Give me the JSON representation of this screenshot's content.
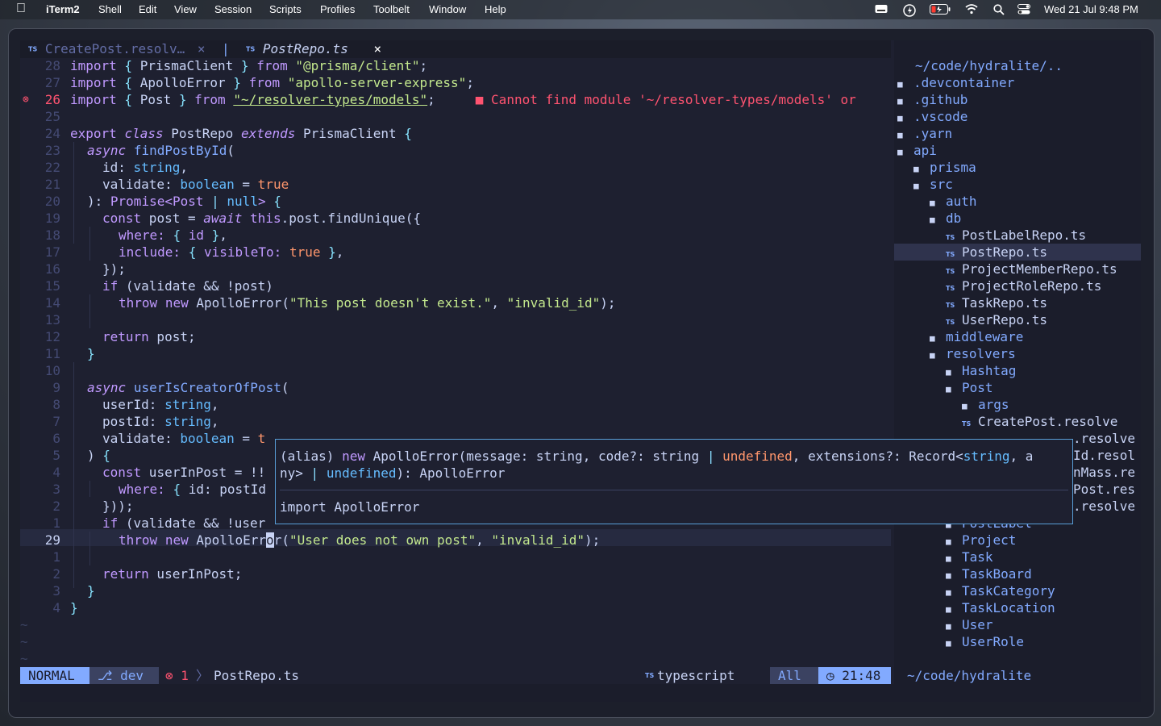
{
  "menubar": {
    "apple": "",
    "app": "iTerm2",
    "items": [
      "Shell",
      "Edit",
      "View",
      "Session",
      "Scripts",
      "Profiles",
      "Toolbelt",
      "Window",
      "Help"
    ],
    "clock": "Wed 21 Jul  9:48 PM"
  },
  "tabs": [
    {
      "badge": "TS",
      "label": "CreatePost.resolv…",
      "close": "×"
    },
    {
      "badge": "TS",
      "label": "PostRepo.ts",
      "close": "×"
    }
  ],
  "tab_separator": "|",
  "lines": [
    {
      "n": "28"
    },
    {
      "n": "27"
    },
    {
      "n": "26"
    },
    {
      "n": "25"
    },
    {
      "n": "24"
    },
    {
      "n": "23"
    },
    {
      "n": "22"
    },
    {
      "n": "21"
    },
    {
      "n": "20"
    },
    {
      "n": "19"
    },
    {
      "n": "18"
    },
    {
      "n": "17"
    },
    {
      "n": "16"
    },
    {
      "n": "15"
    },
    {
      "n": "14"
    },
    {
      "n": "13"
    },
    {
      "n": "12"
    },
    {
      "n": "11"
    },
    {
      "n": "10"
    },
    {
      "n": "9"
    },
    {
      "n": "8"
    },
    {
      "n": "7"
    },
    {
      "n": "6"
    },
    {
      "n": "5"
    },
    {
      "n": "4"
    },
    {
      "n": "3"
    },
    {
      "n": "2"
    },
    {
      "n": "1"
    },
    {
      "n": "29"
    },
    {
      "n": "1"
    },
    {
      "n": "2"
    },
    {
      "n": "3"
    },
    {
      "n": "4"
    }
  ],
  "code": {
    "l28": [
      "import",
      " { ",
      "PrismaClient",
      " } ",
      "from",
      " ",
      "\"@prisma/client\"",
      ";"
    ],
    "l27": [
      "import",
      " { ",
      "ApolloError",
      " } ",
      "from",
      " ",
      "\"apollo-server-express\"",
      ";"
    ],
    "l26": [
      "import",
      " { ",
      "Post",
      " } ",
      "from",
      " ",
      "\"~/resolver-types/models\"",
      ";"
    ],
    "l26_diag": "■ Cannot find module '~/resolver-types/models' or",
    "l24": [
      "export",
      " ",
      "class",
      " PostRepo ",
      "extends",
      " PrismaClient ",
      "{"
    ],
    "l23": [
      "async",
      " ",
      "findPostById",
      "("
    ],
    "l22": [
      "id: ",
      "string",
      ","
    ],
    "l21": [
      "validate: ",
      "boolean",
      " = ",
      "true"
    ],
    "l20": [
      "): ",
      "Promise",
      "<Post ",
      "|",
      " null",
      "> ",
      "{"
    ],
    "l19": [
      "const",
      " post = ",
      "await",
      " ",
      "this",
      ".post.findUnique({"
    ],
    "l18": [
      "where: ",
      "{",
      " id ",
      "}",
      ","
    ],
    "l17": [
      "include: ",
      "{",
      " visibleTo: ",
      "true",
      " ",
      "}",
      ","
    ],
    "l16": "});",
    "l15": [
      "if",
      " (validate && !post)"
    ],
    "l14": [
      "throw",
      " ",
      "new",
      " ApolloError(",
      "\"This post doesn't exist.\"",
      ", ",
      "\"invalid_id\"",
      ");"
    ],
    "l12": [
      "return",
      " post;"
    ],
    "l11": "}",
    "l9": [
      "async",
      " ",
      "userIsCreatorOfPost",
      "("
    ],
    "l8": [
      "userId: ",
      "string",
      ","
    ],
    "l7": [
      "postId: ",
      "string",
      ","
    ],
    "l6": [
      "validate: ",
      "boolean",
      " = ",
      "t"
    ],
    "l5": [
      ") ",
      "{"
    ],
    "l4": [
      "const",
      " userInPost = !!"
    ],
    "l3": [
      "where: ",
      "{",
      " id: postId"
    ],
    "l2": "}));",
    "l1": [
      "if",
      " (validate && !user"
    ],
    "l29": [
      "throw",
      " ",
      "new",
      " ApolloErr",
      "o",
      "r(",
      "\"User does not own post\"",
      ", ",
      "\"invalid_id\"",
      ");"
    ],
    "r2": [
      "return",
      " userInPost;"
    ],
    "r3": "}",
    "r4": "}",
    "tilde": "~"
  },
  "popup": {
    "line1": [
      "(alias) ",
      "new",
      " ApolloError(message: string, code?: string ",
      "|",
      " ",
      "undefined",
      ", extensions?: Record<",
      "string",
      ", a"
    ],
    "line2": [
      "ny> ",
      "|",
      " ",
      "undefined",
      "): ApolloError"
    ],
    "line3": "import ApolloError"
  },
  "tree": {
    "title": "~/code/hydralite/..",
    "folder_glyph": "■",
    "file_badge": "TS",
    "items": [
      {
        "label": ".devcontainer",
        "type": "folder",
        "depth": 0
      },
      {
        "label": ".github",
        "type": "folder",
        "depth": 0
      },
      {
        "label": ".vscode",
        "type": "folder",
        "depth": 0
      },
      {
        "label": ".yarn",
        "type": "folder",
        "depth": 0
      },
      {
        "label": "api",
        "type": "folder",
        "depth": 0
      },
      {
        "label": "prisma",
        "type": "folder",
        "depth": 1
      },
      {
        "label": "src",
        "type": "folder",
        "depth": 1
      },
      {
        "label": "auth",
        "type": "folder",
        "depth": 2
      },
      {
        "label": "db",
        "type": "folder",
        "depth": 2
      },
      {
        "label": "PostLabelRepo.ts",
        "type": "file",
        "depth": 3
      },
      {
        "label": "PostRepo.ts",
        "type": "file",
        "depth": 3,
        "selected": true
      },
      {
        "label": "ProjectMemberRepo.ts",
        "type": "file",
        "depth": 3
      },
      {
        "label": "ProjectRoleRepo.ts",
        "type": "file",
        "depth": 3
      },
      {
        "label": "TaskRepo.ts",
        "type": "file",
        "depth": 3
      },
      {
        "label": "UserRepo.ts",
        "type": "file",
        "depth": 3
      },
      {
        "label": "middleware",
        "type": "folder",
        "depth": 2
      },
      {
        "label": "resolvers",
        "type": "folder",
        "depth": 2
      },
      {
        "label": "Hashtag",
        "type": "folder",
        "depth": 3
      },
      {
        "label": "Post",
        "type": "folder",
        "depth": 3
      },
      {
        "label": "args",
        "type": "folder",
        "depth": 4
      },
      {
        "label": "CreatePost.resolve",
        "type": "file",
        "depth": 4
      }
    ],
    "hidden_fragments": [
      ".resolve",
      "Id.resol",
      "nMass.re",
      "Post.res",
      ".resolve"
    ],
    "items_after": [
      {
        "label": "PostLabel",
        "type": "folder",
        "depth": 3
      },
      {
        "label": "Project",
        "type": "folder",
        "depth": 3
      },
      {
        "label": "Task",
        "type": "folder",
        "depth": 3
      },
      {
        "label": "TaskBoard",
        "type": "folder",
        "depth": 3
      },
      {
        "label": "TaskCategory",
        "type": "folder",
        "depth": 3
      },
      {
        "label": "TaskLocation",
        "type": "folder",
        "depth": 3
      },
      {
        "label": "User",
        "type": "folder",
        "depth": 3
      },
      {
        "label": "UserRole",
        "type": "folder",
        "depth": 3
      }
    ]
  },
  "status": {
    "mode": "NORMAL",
    "branch": "⎇ dev",
    "errors": "⊗ 1",
    "chevron": "〉",
    "file": "PostRepo.ts",
    "lang_badge": "TS",
    "language": "typescript",
    "position": "All",
    "time": "◷ 21:48",
    "cwd": "~/code/hydralite"
  },
  "window_close": "✕"
}
